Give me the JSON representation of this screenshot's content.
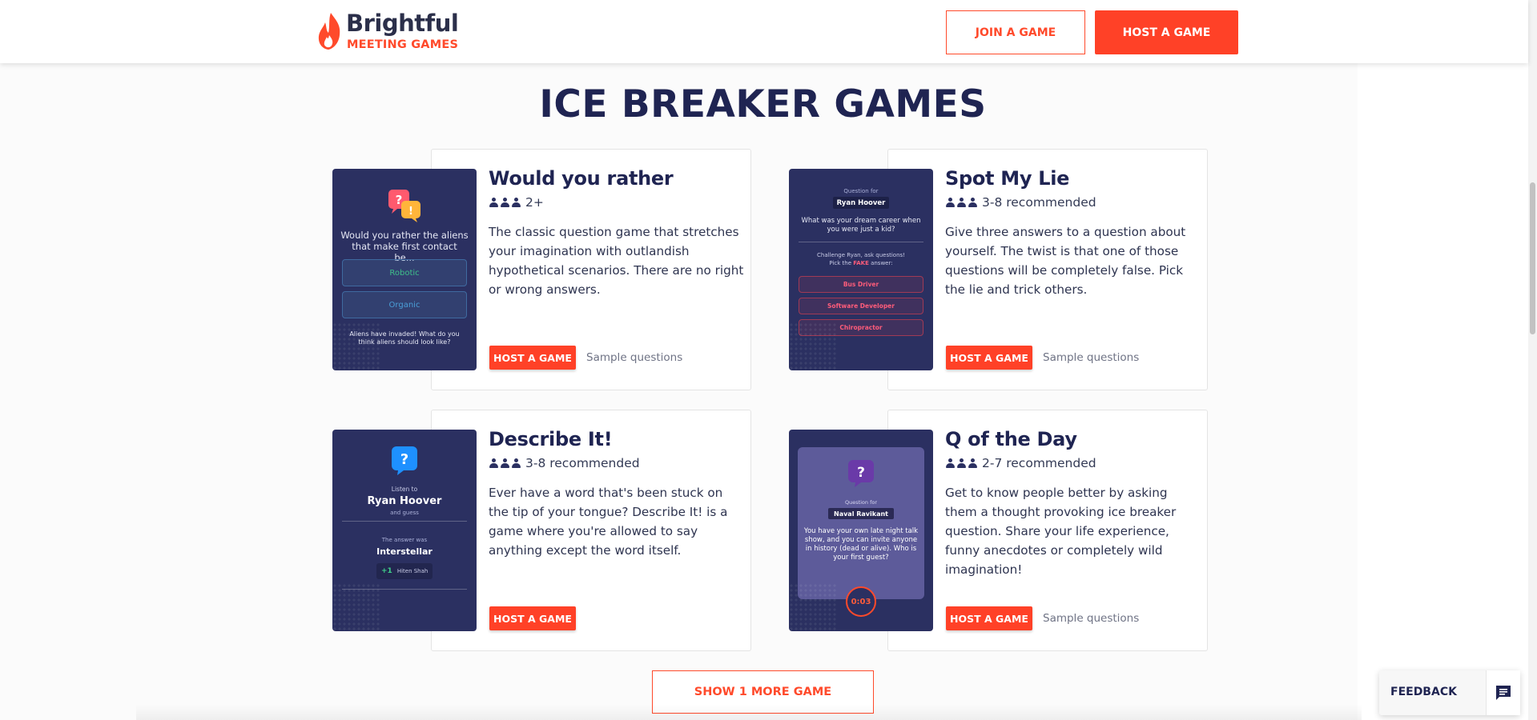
{
  "header": {
    "logo_name": "Brightful",
    "logo_sub": "MEETING GAMES",
    "join_label": "JOIN A GAME",
    "host_label": "HOST A GAME"
  },
  "section_title": "ICE BREAKER GAMES",
  "games": [
    {
      "title": "Would you rather",
      "players": "2+",
      "description": "The classic question game that stretches your imagination with outlandish hypothetical scenarios. There are no right or wrong answers.",
      "host_label": "HOST A GAME",
      "sample_label": "Sample questions",
      "thumb": {
        "question": "Would you rather the aliens that make first contact be...",
        "option_1": "Robotic",
        "option_2": "Organic",
        "footer": "Aliens have invaded! What do you think aliens should look like?"
      }
    },
    {
      "title": "Spot My Lie",
      "players": "3-8 recommended",
      "description": "Give three answers to a question about yourself. The twist is that one of those questions will be completely false. Pick the lie and trick others.",
      "host_label": "HOST A GAME",
      "sample_label": "Sample questions",
      "thumb": {
        "question_for": "Question for",
        "name": "Ryan Hoover",
        "question": "What was your dream career when you were just a kid?",
        "challenge": "Challenge Ryan, ask questions!",
        "pick_prefix": "Pick the ",
        "pick_fake": "FAKE",
        "pick_suffix": " answer:",
        "options": [
          "Bus Driver",
          "Software Developer",
          "Chiropractor"
        ]
      }
    },
    {
      "title": "Describe It!",
      "players": "3-8 recommended",
      "description": "Ever have a word that's been stuck on the tip of your tongue? Describe It! is a game where you're allowed to say anything except the word itself.",
      "host_label": "HOST A GAME",
      "thumb": {
        "listen_to": "Listen to",
        "name": "Ryan Hoover",
        "and_guess": "and guess",
        "answer_was": "The answer was",
        "answer": "Interstellar",
        "points": "+1",
        "player": "Hiten Shah"
      }
    },
    {
      "title": "Q of the Day",
      "players": "2-7 recommended",
      "description": "Get to know people better by asking them a thought provoking ice breaker question. Share your life experience, funny anecdotes or completely wild imagination!",
      "host_label": "HOST A GAME",
      "sample_label": "Sample questions",
      "thumb": {
        "question_for": "Question for",
        "name": "Naval Ravikant",
        "question": "You have your own late night talk show, and you can invite anyone in history (dead or alive). Who is your first guest?",
        "timer": "0:03"
      }
    }
  ],
  "show_more_label": "SHOW 1 MORE GAME",
  "feedback_label": "FEEDBACK",
  "colors": {
    "brand_orange": "#ff4127",
    "navy": "#1f2452",
    "thumb_bg": "#2b3061"
  },
  "icons": [
    "flame-logo-icon",
    "people-icon",
    "question-bubble-icon",
    "chat-icon"
  ]
}
